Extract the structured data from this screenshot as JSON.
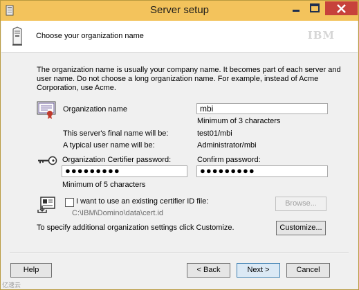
{
  "window": {
    "title": "Server setup",
    "controls": {
      "minimize": "minimize",
      "maximize": "maximize",
      "close": "close"
    },
    "titlebar_color": "#f3c35c",
    "close_color": "#c7423b"
  },
  "header": {
    "title": "Choose your organization name",
    "logo": "IBM"
  },
  "description": "The organization name is usually your company name. It becomes part of each server and user name. Do not choose a long organization name. For example, instead of Acme Corporation, use Acme.",
  "org": {
    "label": "Organization name",
    "value": "mbi",
    "hint": "Minimum of 3 characters",
    "server_name_label": "This server's final name will be:",
    "server_name_value": "test01/mbi",
    "user_name_label": "A typical user name will be:",
    "user_name_value": "Administrator/mbi"
  },
  "password": {
    "label": "Organization Certifier password:",
    "value": "●●●●●●●●●",
    "confirm_label": "Confirm password:",
    "confirm_value": "●●●●●●●●●",
    "hint": "Minimum of 5 characters"
  },
  "certifier": {
    "checkbox_label": "I want to use an existing certifier ID file:",
    "checked": false,
    "path": "C:\\IBM\\Domino\\data\\cert.id",
    "browse_label": "Browse..."
  },
  "customize": {
    "text": "To specify additional organization settings click Customize.",
    "button_label": "Customize..."
  },
  "buttons": {
    "help": "Help",
    "back": "< Back",
    "next": "Next >",
    "cancel": "Cancel"
  },
  "watermark": "亿速云"
}
